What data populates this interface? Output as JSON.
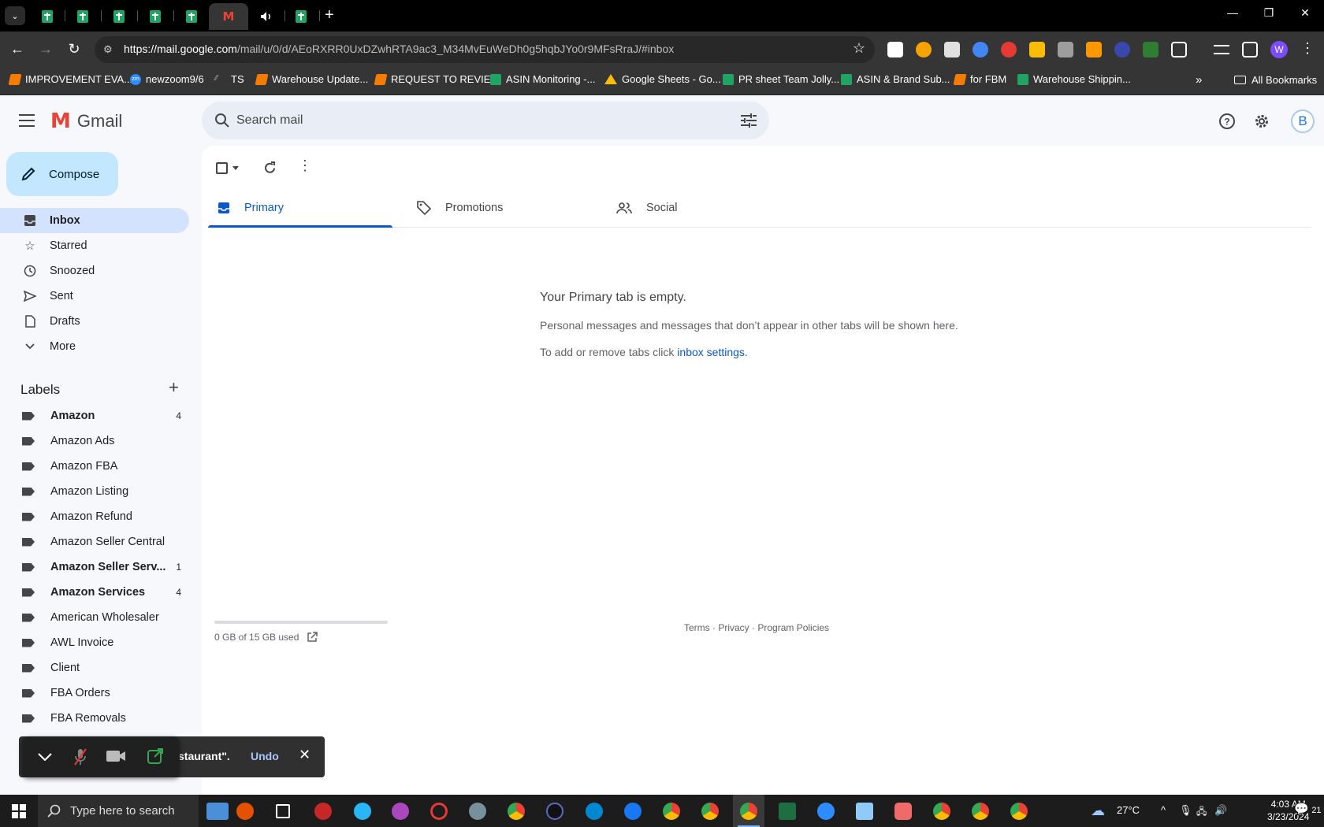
{
  "browser": {
    "tabs": [
      {
        "icon": "google-sheets-icon"
      },
      {
        "icon": "google-sheets-icon"
      },
      {
        "icon": "google-sheets-icon"
      },
      {
        "icon": "google-sheets-icon"
      },
      {
        "icon": "google-sheets-icon"
      },
      {
        "icon": "gmail-icon",
        "active": true
      },
      {
        "icon": "speaker-icon"
      },
      {
        "icon": "google-sheets-icon"
      }
    ],
    "url_host": "https://mail.google.com",
    "url_path": "/mail/u/0/d/AEoRXRR0UxDZwhRTA9ac3_M34MvEuWeDh0g5hqbJYo0r9MFsRraJ/#inbox",
    "profile_initial": "W",
    "bookmarks": [
      {
        "label": "IMPROVEMENT EVA...",
        "icon": "orange"
      },
      {
        "label": "newzoom9/6",
        "icon": "zoom"
      },
      {
        "label": "TS",
        "icon": "ts"
      },
      {
        "label": "Warehouse Update...",
        "icon": "orange"
      },
      {
        "label": "REQUEST TO REVIE...",
        "icon": "orange"
      },
      {
        "label": "ASIN Monitoring -...",
        "icon": "green"
      },
      {
        "label": "Google Sheets - Go...",
        "icon": "drive"
      },
      {
        "label": "PR sheet Team Jolly...",
        "icon": "green"
      },
      {
        "label": "ASIN & Brand Sub...",
        "icon": "green"
      },
      {
        "label": "for FBM",
        "icon": "orange"
      },
      {
        "label": "Warehouse Shippin...",
        "icon": "green"
      }
    ],
    "all_bookmarks": "All Bookmarks"
  },
  "gmail": {
    "product_name": "Gmail",
    "search_placeholder": "Search mail",
    "account_initial": "B",
    "compose_label": "Compose",
    "nav": [
      {
        "label": "Inbox",
        "icon": "inbox-icon",
        "active": true
      },
      {
        "label": "Starred",
        "icon": "star-icon"
      },
      {
        "label": "Snoozed",
        "icon": "clock-icon"
      },
      {
        "label": "Sent",
        "icon": "send-icon"
      },
      {
        "label": "Drafts",
        "icon": "draft-icon"
      },
      {
        "label": "More",
        "icon": "chevron-down-icon"
      }
    ],
    "labels_heading": "Labels",
    "labels": [
      {
        "name": "Amazon",
        "count": "4",
        "bold": true
      },
      {
        "name": "Amazon Ads",
        "count": ""
      },
      {
        "name": "Amazon FBA",
        "count": ""
      },
      {
        "name": "Amazon Listing",
        "count": ""
      },
      {
        "name": "Amazon Refund",
        "count": ""
      },
      {
        "name": "Amazon Seller Central",
        "count": ""
      },
      {
        "name": "Amazon Seller Serv...",
        "count": "1",
        "bold": true
      },
      {
        "name": "Amazon Services",
        "count": "4",
        "bold": true
      },
      {
        "name": "American Wholesaler",
        "count": ""
      },
      {
        "name": "AWL Invoice",
        "count": ""
      },
      {
        "name": "Client",
        "count": ""
      },
      {
        "name": "FBA Orders",
        "count": ""
      },
      {
        "name": "FBA Removals",
        "count": ""
      }
    ],
    "tabs": [
      {
        "label": "Primary",
        "icon": "inbox-tab-icon",
        "active": true
      },
      {
        "label": "Promotions",
        "icon": "tag-icon"
      },
      {
        "label": "Social",
        "icon": "people-icon"
      }
    ],
    "empty": {
      "title": "Your Primary tab is empty.",
      "line1": "Personal messages and messages that don’t appear in other tabs will be shown here.",
      "line2_prefix": "To add or remove tabs click ",
      "line2_link": "inbox settings."
    },
    "storage": {
      "text": "0 GB of 15 GB used",
      "fraction": 0.0
    },
    "footer": {
      "terms": "Terms",
      "privacy": "Privacy",
      "policies": "Program Policies",
      "sep": " · "
    },
    "snackbar": {
      "message": "staurant\".",
      "undo": "Undo"
    }
  },
  "taskbar": {
    "search_placeholder": "Type here to search",
    "temperature": "27°C",
    "time": "4:03 AM",
    "date": "3/23/2024",
    "notification_count": "21"
  }
}
